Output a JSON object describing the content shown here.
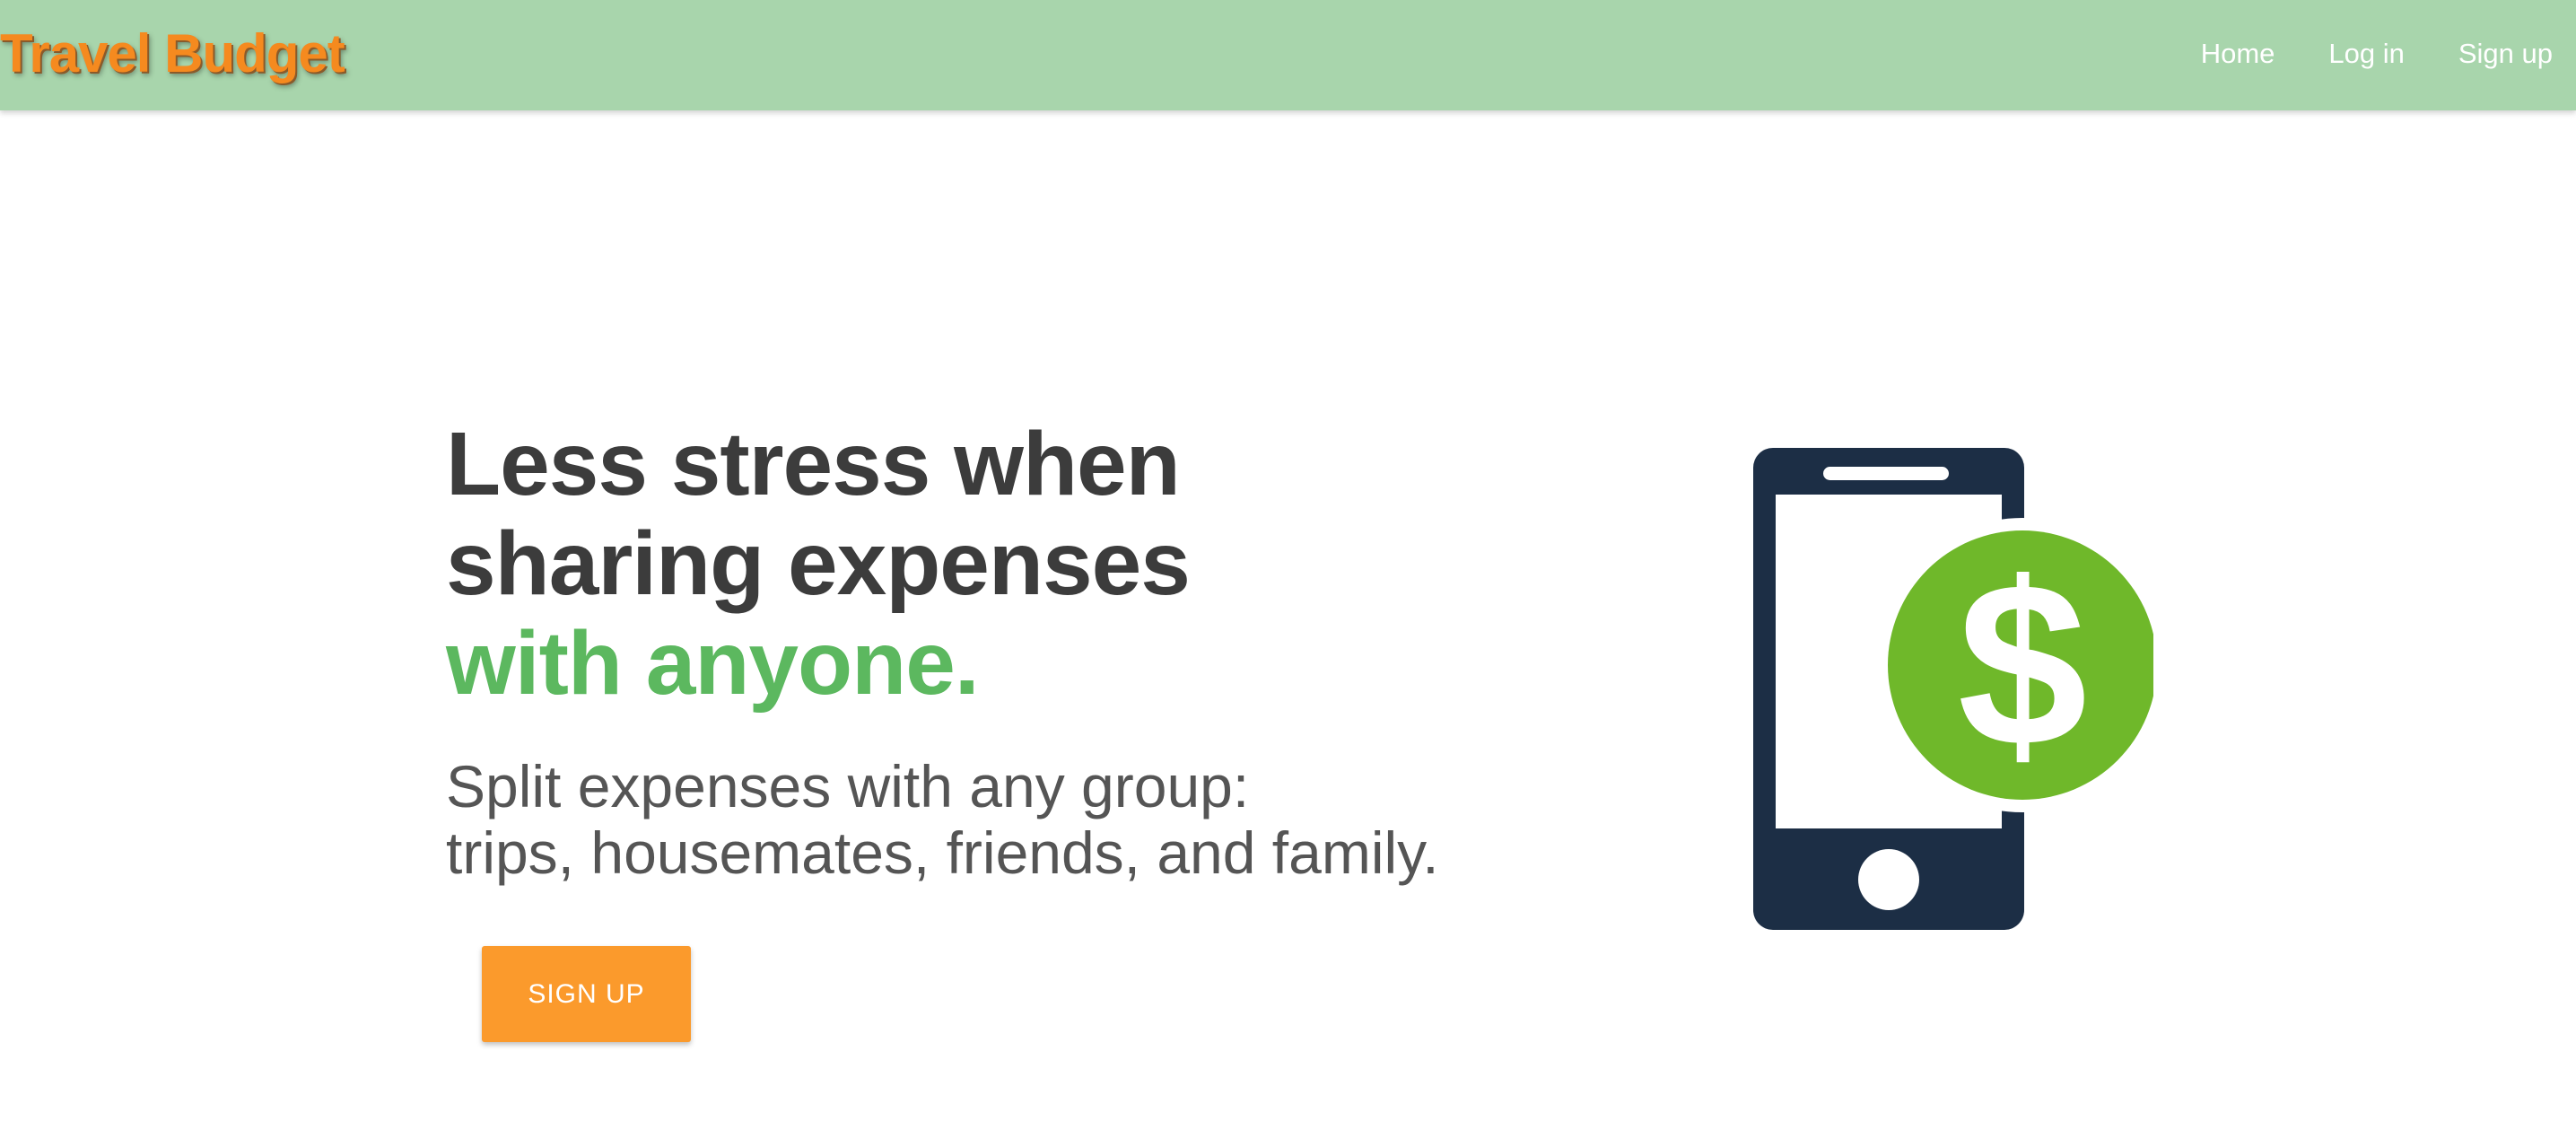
{
  "navbar": {
    "brand": "Travel Budget",
    "links": [
      {
        "label": "Home"
      },
      {
        "label": "Log in"
      },
      {
        "label": "Sign up"
      }
    ],
    "background_color": "#a8d5ac",
    "brand_color": "#f58a1f"
  },
  "hero": {
    "headline_line1": "Less stress when",
    "headline_line2": "sharing expenses",
    "headline_accent": "with anyone.",
    "subtitle_line1": "Split expenses with any group:",
    "subtitle_line2": "trips, housemates, friends, and family.",
    "cta_label": "SIGN UP",
    "accent_color": "#5cb85f",
    "cta_color": "#fb9a2c"
  },
  "illustration": {
    "icon": "phone-dollar-icon",
    "phone_color": "#1c2e45",
    "coin_color": "#6fb82a",
    "symbol": "$"
  }
}
